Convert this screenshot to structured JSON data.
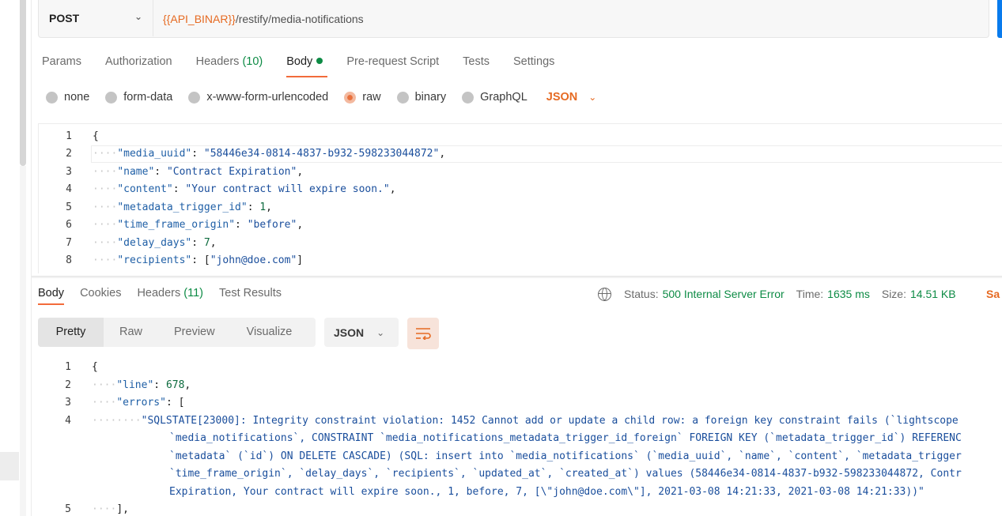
{
  "request": {
    "method": "POST",
    "url_variable": "{{API_BINAR}}",
    "url_path": "/restify/media-notifications"
  },
  "request_tabs": [
    {
      "label": "Params"
    },
    {
      "label": "Authorization"
    },
    {
      "label": "Headers",
      "count": "(10)"
    },
    {
      "label": "Body"
    },
    {
      "label": "Pre-request Script"
    },
    {
      "label": "Tests"
    },
    {
      "label": "Settings"
    }
  ],
  "body_modes": [
    {
      "label": "none"
    },
    {
      "label": "form-data"
    },
    {
      "label": "x-www-form-urlencoded"
    },
    {
      "label": "raw"
    },
    {
      "label": "binary"
    },
    {
      "label": "GraphQL"
    }
  ],
  "body_format": "JSON",
  "request_body_lines": [
    {
      "n": "1",
      "text": "{"
    },
    {
      "n": "2",
      "key": "\"media_uuid\"",
      "val": "\"58446e34-0814-4837-b932-598233044872\"",
      "tail": ","
    },
    {
      "n": "3",
      "key": "\"name\"",
      "val": "\"Contract Expiration\"",
      "tail": ","
    },
    {
      "n": "4",
      "key": "\"content\"",
      "val": "\"Your contract will expire soon.\"",
      "tail": ","
    },
    {
      "n": "5",
      "key": "\"metadata_trigger_id\"",
      "num": "1",
      "tail": ","
    },
    {
      "n": "6",
      "key": "\"time_frame_origin\"",
      "val": "\"before\"",
      "tail": ","
    },
    {
      "n": "7",
      "key": "\"delay_days\"",
      "num": "7",
      "tail": ","
    },
    {
      "n": "8",
      "key": "\"recipients\"",
      "pre": "[",
      "val": "\"john@doe.com\"",
      "tail": "]"
    }
  ],
  "response_tabs": [
    {
      "label": "Body"
    },
    {
      "label": "Cookies"
    },
    {
      "label": "Headers",
      "count": "(11)"
    },
    {
      "label": "Test Results"
    }
  ],
  "status": {
    "status_label": "Status:",
    "status_value": "500 Internal Server Error",
    "time_label": "Time:",
    "time_value": "1635 ms",
    "size_label": "Size:",
    "size_value": "14.51 KB",
    "save_label": "Sa"
  },
  "view_modes": [
    {
      "label": "Pretty"
    },
    {
      "label": "Raw"
    },
    {
      "label": "Preview"
    },
    {
      "label": "Visualize"
    }
  ],
  "response_format": "JSON",
  "response_lines": [
    {
      "n": "1",
      "text": "{"
    },
    {
      "n": "2",
      "key": "\"line\"",
      "num": "678",
      "tail": ","
    },
    {
      "n": "3",
      "key": "\"errors\"",
      "pre": "[",
      "tail": ""
    },
    {
      "n": "4",
      "err": "\"SQLSTATE[23000]: Integrity constraint violation: 1452 Cannot add or update a child row: a foreign key constraint fails (`lightscope"
    },
    {
      "n": "",
      "err": "`media_notifications`, CONSTRAINT `media_notifications_metadata_trigger_id_foreign` FOREIGN KEY (`metadata_trigger_id`) REFERENC"
    },
    {
      "n": "",
      "err": "`metadata` (`id`) ON DELETE CASCADE) (SQL: insert into `media_notifications` (`media_uuid`, `name`, `content`, `metadata_trigger"
    },
    {
      "n": "",
      "err": "`time_frame_origin`, `delay_days`, `recipients`, `updated_at`, `created_at`) values (58446e34-0814-4837-b932-598233044872, Contr"
    },
    {
      "n": "",
      "err": "Expiration, Your contract will expire soon., 1, before, 7, [\\\"john@doe.com\\\"], 2021-03-08 14:21:33, 2021-03-08 14:21:33))\""
    },
    {
      "n": "5",
      "text": "],"
    }
  ]
}
